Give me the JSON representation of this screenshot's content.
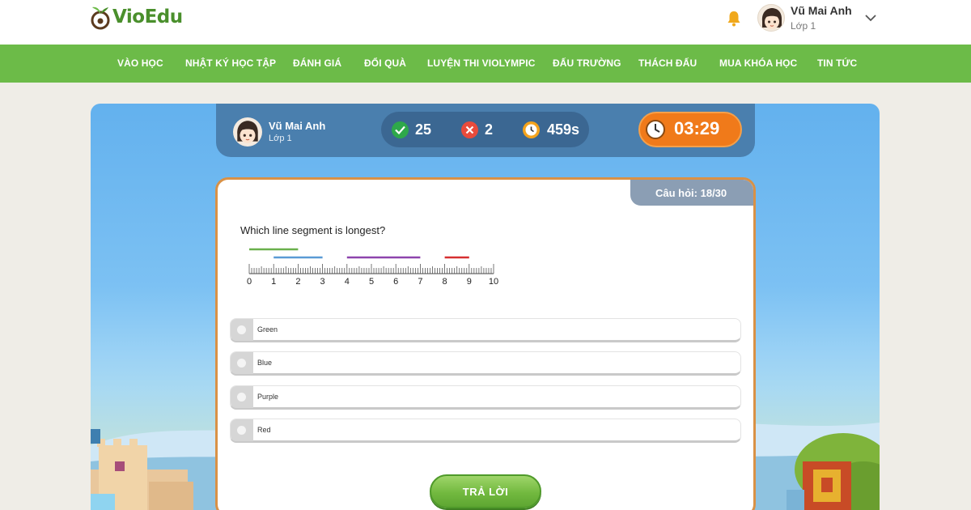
{
  "app": {
    "logo_text": "VioEdu"
  },
  "header": {
    "bell_icon": "bell-icon",
    "user": {
      "name": "Vũ Mai Anh",
      "class": "Lớp 1"
    },
    "chevron_icon": "chevron-down-icon"
  },
  "nav": {
    "items": [
      {
        "label": "VÀO HỌC"
      },
      {
        "label": "NHẬT KÝ HỌC TẬP"
      },
      {
        "label": "ĐÁNH GIÁ"
      },
      {
        "label": "ĐỔI QUÀ"
      },
      {
        "label": "LUYỆN THI VIOLYMPIC"
      },
      {
        "label": "ĐẤU TRƯỜNG"
      },
      {
        "label": "THÁCH ĐẤU"
      },
      {
        "label": "MUA KHÓA HỌC"
      },
      {
        "label": "TIN TỨC"
      }
    ]
  },
  "quiz_status": {
    "player": {
      "name": "Vũ Mai Anh",
      "class": "Lớp 1"
    },
    "correct": "25",
    "wrong": "2",
    "time_spent": "459s",
    "countdown": "03:29"
  },
  "question": {
    "counter": "Câu hỏi: 18/30",
    "text": "Which line segment is longest?",
    "ruler": {
      "min": 0,
      "max": 10,
      "labels": [
        "0",
        "1",
        "2",
        "3",
        "4",
        "5",
        "6",
        "7",
        "8",
        "9",
        "10"
      ],
      "segments": [
        {
          "color": "#6ab04c",
          "start": 0,
          "end": 2
        },
        {
          "color": "#5b9bd5",
          "start": 1,
          "end": 3
        },
        {
          "color": "#8e44ad",
          "start": 4,
          "end": 7
        },
        {
          "color": "#d63031",
          "start": 8,
          "end": 9
        }
      ]
    },
    "options": [
      {
        "label": "Green"
      },
      {
        "label": "Blue"
      },
      {
        "label": "Purple"
      },
      {
        "label": "Red"
      }
    ],
    "submit_label": "TRẢ LỜI"
  },
  "colors": {
    "nav_green": "#6cbb48",
    "timer_orange": "#f07a1a",
    "card_border": "#d99146"
  }
}
